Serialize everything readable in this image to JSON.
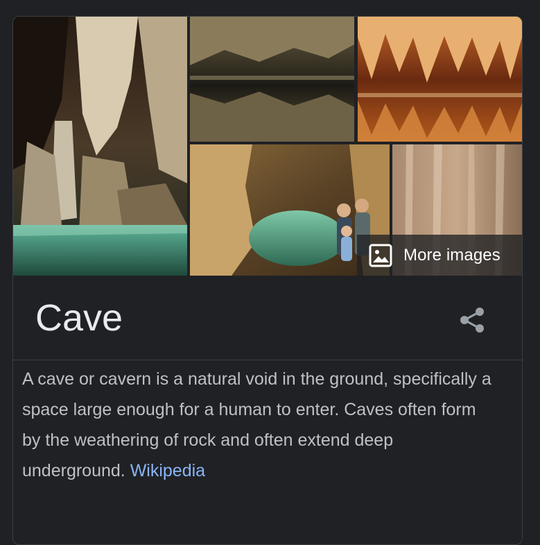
{
  "knowledge_panel": {
    "images": {
      "more_images_label": "More images",
      "more_images_icon": "image-icon"
    },
    "title": "Cave",
    "share_icon": "share-icon",
    "description": "A cave or cavern is a natural void in the ground, specifically a space large enough for a human to enter. Caves often form by the weathering of rock and often extend deep underground.",
    "source_link": "Wikipedia"
  },
  "colors": {
    "background": "#202124",
    "title": "#e8eaed",
    "text": "#bdc1c6",
    "link": "#8ab4f8",
    "divider": "#3c4043"
  }
}
